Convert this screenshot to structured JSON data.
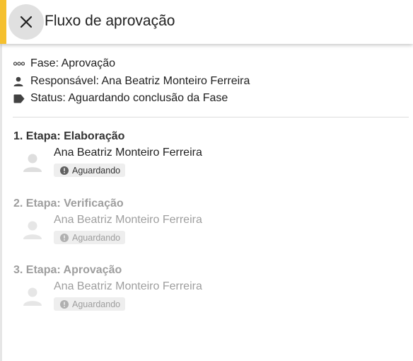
{
  "header": {
    "title": "Fluxo de aprovação",
    "close_icon": "close-icon"
  },
  "info": {
    "phase": "Fase: Aprovação",
    "responsible": "Responsável: Ana Beatriz Monteiro Ferreira",
    "status": "Status: Aguardando conclusão da Fase"
  },
  "stages": [
    {
      "title": "1. Etapa: Elaboração",
      "person": "Ana Beatriz Monteiro Ferreira",
      "status": "Aguardando"
    },
    {
      "title": "2. Etapa: Verificação",
      "person": "Ana Beatriz Monteiro Ferreira",
      "status": "Aguardando"
    },
    {
      "title": "3. Etapa: Aprovação",
      "person": "Ana Beatriz Monteiro Ferreira",
      "status": "Aguardando"
    }
  ],
  "colors": {
    "accent": "#f5c02e",
    "muted_text": "#9e9e9e"
  }
}
